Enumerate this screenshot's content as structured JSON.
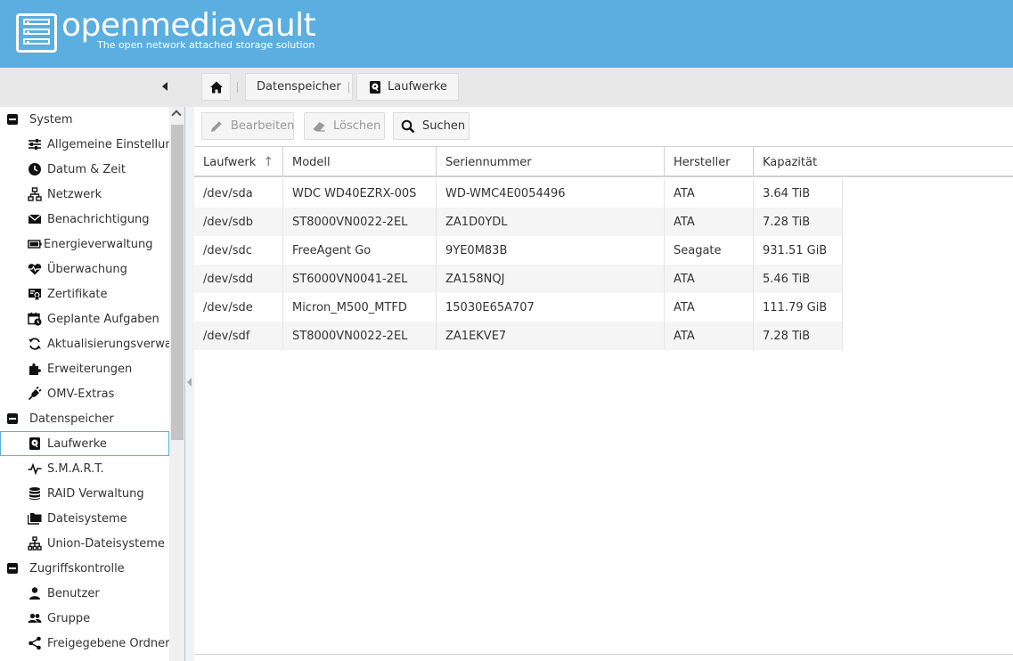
{
  "header": {
    "title": "openmediavault",
    "subtitle": "The open network attached storage solution"
  },
  "breadcrumb": {
    "items": [
      "Datenspeicher",
      "Laufwerke"
    ]
  },
  "sidebar": {
    "groups": [
      {
        "label": "System",
        "items": [
          {
            "label": "Allgemeine Einstellungen",
            "icon": "sliders-icon"
          },
          {
            "label": "Datum & Zeit",
            "icon": "clock-icon"
          },
          {
            "label": "Netzwerk",
            "icon": "network-icon"
          },
          {
            "label": "Benachrichtigung",
            "icon": "envelope-icon"
          },
          {
            "label": "Energieverwaltung",
            "icon": "battery-icon"
          },
          {
            "label": "Überwachung",
            "icon": "heart-pulse-icon"
          },
          {
            "label": "Zertifikate",
            "icon": "certificate-icon"
          },
          {
            "label": "Geplante Aufgaben",
            "icon": "calendar-clock-icon"
          },
          {
            "label": "Aktualisierungsverwaltung",
            "icon": "refresh-icon"
          },
          {
            "label": "Erweiterungen",
            "icon": "puzzle-icon"
          },
          {
            "label": "OMV-Extras",
            "icon": "plug-icon"
          }
        ]
      },
      {
        "label": "Datenspeicher",
        "items": [
          {
            "label": "Laufwerke",
            "icon": "harddisk-icon",
            "selected": true
          },
          {
            "label": "S.M.A.R.T.",
            "icon": "pulse-icon"
          },
          {
            "label": "RAID Verwaltung",
            "icon": "database-icon"
          },
          {
            "label": "Dateisysteme",
            "icon": "folders-icon"
          },
          {
            "label": "Union-Dateisysteme",
            "icon": "sitemap-icon"
          }
        ]
      },
      {
        "label": "Zugriffskontrolle",
        "items": [
          {
            "label": "Benutzer",
            "icon": "user-icon"
          },
          {
            "label": "Gruppe",
            "icon": "users-icon"
          },
          {
            "label": "Freigegebene Ordner",
            "icon": "share-icon"
          }
        ]
      }
    ]
  },
  "toolbar": {
    "edit_label": "Bearbeiten",
    "delete_label": "Löschen",
    "search_label": "Suchen"
  },
  "grid": {
    "columns": [
      "Laufwerk",
      "Modell",
      "Seriennummer",
      "Hersteller",
      "Kapazität"
    ],
    "rows": [
      [
        "/dev/sda",
        "WDC WD40EZRX-00S",
        "WD-WMC4E0054496",
        "ATA",
        "3.64 TiB"
      ],
      [
        "/dev/sdb",
        "ST8000VN0022-2EL",
        "ZA1D0YDL",
        "ATA",
        "7.28 TiB"
      ],
      [
        "/dev/sdc",
        "FreeAgent Go",
        "9YE0M83B",
        "Seagate",
        "931.51 GiB"
      ],
      [
        "/dev/sdd",
        "ST6000VN0041-2EL",
        "ZA158NQJ",
        "ATA",
        "5.46 TiB"
      ],
      [
        "/dev/sde",
        "Micron_M500_MTFD",
        "15030E65A707",
        "ATA",
        "111.79 GiB"
      ],
      [
        "/dev/sdf",
        "ST8000VN0022-2EL",
        "ZA1EKVE7",
        "ATA",
        "7.28 TiB"
      ]
    ]
  }
}
